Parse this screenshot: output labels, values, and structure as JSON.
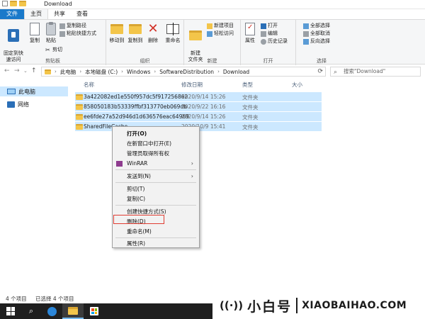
{
  "window": {
    "title": "Download"
  },
  "ribbon_tabs": [
    "文件",
    "主页",
    "共享",
    "查看"
  ],
  "ribbon": {
    "clipboard": {
      "pin_label": "固定到快\n速访问",
      "copy_label": "复制",
      "paste_label": "粘贴",
      "copy_path_label": "复制路径",
      "paste_shortcut_label": "粘贴快捷方式",
      "cut_label": "剪切",
      "group_label": "剪贴板"
    },
    "organize": {
      "move_to_label": "移动到",
      "copy_to_label": "复制到",
      "delete_label": "删除",
      "rename_label": "重命名",
      "group_label": "组织"
    },
    "new": {
      "new_folder_label": "新建\n文件夹",
      "new_item_label": "新建项目",
      "easy_access_label": "轻松访问",
      "group_label": "新建"
    },
    "open": {
      "properties_label": "属性",
      "open_label": "打开",
      "edit_label": "编辑",
      "history_label": "历史记录",
      "group_label": "打开"
    },
    "select": {
      "select_all_label": "全部选择",
      "select_none_label": "全部取消",
      "invert_label": "反向选择",
      "group_label": "选择"
    }
  },
  "address": {
    "crumbs": [
      "此电脑",
      "本地磁盘 (C:)",
      "Windows",
      "SoftwareDistribution",
      "Download"
    ],
    "search_placeholder": "搜索\"Download\""
  },
  "nav_pane": {
    "items": [
      "此电脑",
      "网络"
    ]
  },
  "file_list": {
    "columns": [
      "名称",
      "修改日期",
      "类型",
      "大小"
    ],
    "rows": [
      {
        "name": "3a422082ed1e550f957dc5f917256862",
        "date": "2020/9/14 15:26",
        "type": "文件夹"
      },
      {
        "name": "858050183b53339ffbf313770eb069db",
        "date": "2020/9/22 16:16",
        "type": "文件夹"
      },
      {
        "name": "ee6fde27a52d946d1d636576eac64969",
        "date": "2020/9/14 15:26",
        "type": "文件夹"
      },
      {
        "name": "SharedFileCache",
        "date": "2020/10/9 15:41",
        "type": "文件夹"
      }
    ]
  },
  "context_menu": {
    "items": [
      "打开(O)",
      "在新窗口中打开(E)",
      "管理员取得所有权",
      "WinRAR",
      "发送到(N)",
      "剪切(T)",
      "复制(C)",
      "创建快捷方式(S)",
      "删除(D)",
      "重命名(M)",
      "属性(R)"
    ],
    "highlighted": "删除(D)"
  },
  "status_bar": {
    "item_count": "4 个项目",
    "selected_count": "已选择 4 个项目"
  },
  "watermark": {
    "brand_cn": "小白号",
    "brand_en": "XIAOBAIHAO.COM"
  },
  "colors": {
    "selection": "#cce8ff",
    "file_tab": "#1979ca",
    "highlight_box": "#e03c31",
    "taskbar": "#1f1f1f"
  }
}
